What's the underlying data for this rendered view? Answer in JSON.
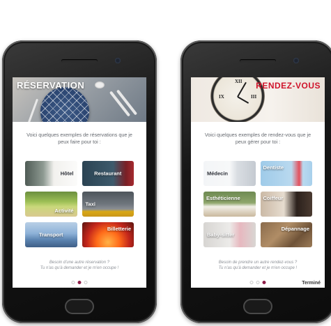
{
  "screens": [
    {
      "banner_title": "RÉSERVATION",
      "intro": "Voici quelques exemples de réservations que je peux faire pour toi :",
      "tiles": [
        {
          "label": "Hôtel"
        },
        {
          "label": "Restaurant"
        },
        {
          "label": "Activité"
        },
        {
          "label": "Taxi"
        },
        {
          "label": "Transport"
        },
        {
          "label": "Billetterie"
        }
      ],
      "footer_line1": "Besoin d'une autre réservation ?",
      "footer_line2": "Tu n'as qu'à demander et je m'en occupe !",
      "active_page": 2,
      "done_label": ""
    },
    {
      "banner_title": "RENDEZ-VOUS",
      "intro": "Voici quelques exemples de rendez-vous que je peux gérer pour toi :",
      "tiles": [
        {
          "label": "Médecin"
        },
        {
          "label": "Dentiste"
        },
        {
          "label": "Esthéticienne"
        },
        {
          "label": "Coiffeur"
        },
        {
          "label": "Baby-sitter"
        },
        {
          "label": "Dépannage"
        }
      ],
      "footer_line1": "Besoin de prendre un autre rendez-vous ?",
      "footer_line2": "Tu n'as qu'à demander et je m'en occupe !",
      "active_page": 3,
      "done_label": "Terminé"
    }
  ],
  "colors": {
    "accent": "#d0142b",
    "page_dot_active": "#8e1e48",
    "text_muted": "#666a70"
  }
}
